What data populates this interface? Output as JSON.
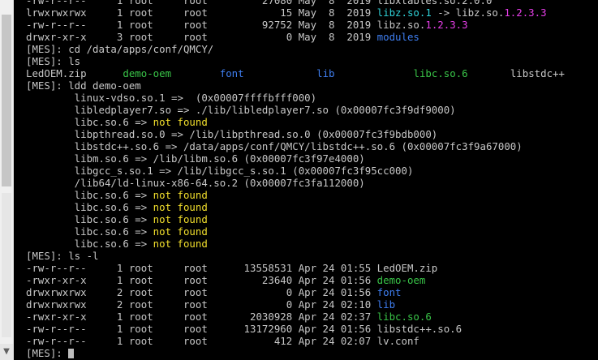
{
  "colors": {
    "background": "#000000",
    "default_text": "#c7c7c7",
    "directory": "#3f7ff2",
    "executable": "#39c448",
    "not_found": "#f2df2c",
    "symlink": "#2fd2d8",
    "link_target_version": "#e63ee8"
  },
  "scrollbar": {
    "down_arrow_icon": "triangle-down"
  },
  "terminal": {
    "lines": [
      [
        {
          "t": "-rw-r--r--     1 root     root         27080 May  8  2019 libxtables.so.2.0.0",
          "c": "gray"
        }
      ],
      [
        {
          "t": "lrwxrwxrwx     1 root     root            15 May  8  2019 ",
          "c": "gray"
        },
        {
          "t": "libz.so.1",
          "c": "cyan"
        },
        {
          "t": " -> libz.so.",
          "c": "gray"
        },
        {
          "t": "1.2.3.3",
          "c": "magenta"
        }
      ],
      [
        {
          "t": "-rw-r--r--     1 root     root         92752 May  8  2019 libz.so.",
          "c": "gray"
        },
        {
          "t": "1.2.3.3",
          "c": "magenta"
        }
      ],
      [
        {
          "t": "drwxr-xr-x     3 root     root             0 May  8  2019 ",
          "c": "gray"
        },
        {
          "t": "modules",
          "c": "blue"
        }
      ],
      [
        {
          "t": "[MES]: cd /data/apps/conf/QMCY/",
          "c": "gray"
        }
      ],
      [
        {
          "t": "[MES]: ls",
          "c": "gray"
        }
      ],
      [
        {
          "t": "LedOEM.zip      ",
          "c": "gray"
        },
        {
          "t": "demo-oem",
          "c": "green"
        },
        {
          "t": "        ",
          "c": "gray"
        },
        {
          "t": "font",
          "c": "blue"
        },
        {
          "t": "            ",
          "c": "gray"
        },
        {
          "t": "lib",
          "c": "blue"
        },
        {
          "t": "             ",
          "c": "gray"
        },
        {
          "t": "libc.so.6",
          "c": "green"
        },
        {
          "t": "       libstdc++",
          "c": "gray"
        }
      ],
      [
        {
          "t": "[MES]: ldd demo-oem",
          "c": "gray"
        }
      ],
      [
        {
          "t": "        linux-vdso.so.1 =>  (0x00007ffffbfff000)",
          "c": "gray"
        }
      ],
      [
        {
          "t": "        libledplayer7.so => ./lib/libledplayer7.so (0x00007fc3f9df9000)",
          "c": "gray"
        }
      ],
      [
        {
          "t": "        libc.so.6 => ",
          "c": "gray"
        },
        {
          "t": "not found",
          "c": "yellow"
        }
      ],
      [
        {
          "t": "        libpthread.so.0 => /lib/libpthread.so.0 (0x00007fc3f9bdb000)",
          "c": "gray"
        }
      ],
      [
        {
          "t": "        libstdc++.so.6 => /data/apps/conf/QMCY/libstdc++.so.6 (0x00007fc3f9a67000)",
          "c": "gray"
        }
      ],
      [
        {
          "t": "        libm.so.6 => /lib/libm.so.6 (0x00007fc3f97e4000)",
          "c": "gray"
        }
      ],
      [
        {
          "t": "        libgcc_s.so.1 => /lib/libgcc_s.so.1 (0x00007fc3f95cc000)",
          "c": "gray"
        }
      ],
      [
        {
          "t": "        /lib64/ld-linux-x86-64.so.2 (0x00007fc3fa112000)",
          "c": "gray"
        }
      ],
      [
        {
          "t": "        libc.so.6 => ",
          "c": "gray"
        },
        {
          "t": "not found",
          "c": "yellow"
        }
      ],
      [
        {
          "t": "        libc.so.6 => ",
          "c": "gray"
        },
        {
          "t": "not found",
          "c": "yellow"
        }
      ],
      [
        {
          "t": "        libc.so.6 => ",
          "c": "gray"
        },
        {
          "t": "not found",
          "c": "yellow"
        }
      ],
      [
        {
          "t": "        libc.so.6 => ",
          "c": "gray"
        },
        {
          "t": "not found",
          "c": "yellow"
        }
      ],
      [
        {
          "t": "        libc.so.6 => ",
          "c": "gray"
        },
        {
          "t": "not found",
          "c": "yellow"
        }
      ],
      [
        {
          "t": "[MES]: ls -l",
          "c": "gray"
        }
      ],
      [
        {
          "t": "-rw-r--r--     1 root     root      13558531 Apr 24 01:55 LedOEM.zip",
          "c": "gray"
        }
      ],
      [
        {
          "t": "-rwxr-xr-x     1 root     root         23640 Apr 24 01:56 ",
          "c": "gray"
        },
        {
          "t": "demo-oem",
          "c": "green"
        }
      ],
      [
        {
          "t": "drwxrwxrwx     2 root     root             0 Apr 24 01:56 ",
          "c": "gray"
        },
        {
          "t": "font",
          "c": "blue"
        }
      ],
      [
        {
          "t": "drwxrwxrwx     2 root     root             0 Apr 24 02:10 ",
          "c": "gray"
        },
        {
          "t": "lib",
          "c": "blue"
        }
      ],
      [
        {
          "t": "-rwxr-xr-x     1 root     root       2030928 Apr 24 02:37 ",
          "c": "gray"
        },
        {
          "t": "libc.so.6",
          "c": "green"
        }
      ],
      [
        {
          "t": "-rw-r--r--     1 root     root      13172960 Apr 24 01:56 libstdc++.so.6",
          "c": "gray"
        }
      ],
      [
        {
          "t": "-rw-r--r--     1 root     root           412 Apr 24 02:07 lv.conf",
          "c": "gray"
        }
      ],
      [
        {
          "t": "[MES]: ",
          "c": "gray"
        }
      ]
    ]
  }
}
